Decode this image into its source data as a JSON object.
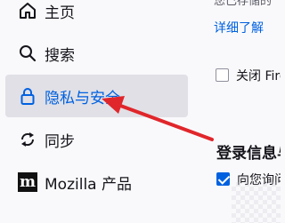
{
  "sidebar": {
    "items": [
      {
        "label": "主页",
        "icon": "home-icon",
        "selected": false
      },
      {
        "label": "搜索",
        "icon": "search-icon",
        "selected": false
      },
      {
        "label": "隐私与安全",
        "icon": "lock-icon",
        "selected": true
      },
      {
        "label": "同步",
        "icon": "sync-icon",
        "selected": false
      },
      {
        "label": "Mozilla 产品",
        "icon": "mozilla-icon",
        "badge": "m",
        "selected": false
      }
    ]
  },
  "content": {
    "truncated_text": "您已存储的",
    "learn_more": "详细了解",
    "close_option_label": "关闭 Fire",
    "login_section_title": "登录信息与",
    "ask_save_label": "向您询问"
  },
  "colors": {
    "accent": "#0061e0",
    "selected_bg": "#e0e0e6",
    "arrow": "#e0262b"
  }
}
